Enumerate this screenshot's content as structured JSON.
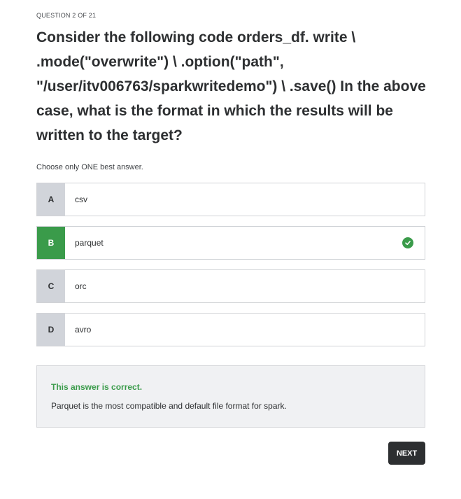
{
  "quiz": {
    "counter": "QUESTION 2 OF 21",
    "question": "Consider the following code orders_df. write \\ .mode(\"overwrite\") \\ .option(\"path\", \"/user/itv006763/sparkwritedemo\") \\ .save() In the above case, what is the format in which the results will be written to the target?",
    "instruction": "Choose only ONE best answer."
  },
  "options": [
    {
      "letter": "A",
      "text": "csv"
    },
    {
      "letter": "B",
      "text": "parquet",
      "correct": true
    },
    {
      "letter": "C",
      "text": "orc"
    },
    {
      "letter": "D",
      "text": "avro"
    }
  ],
  "feedback": {
    "title": "This answer is correct.",
    "explanation": "Parquet is the most compatible and default file format for spark."
  },
  "actions": {
    "next_label": "NEXT"
  },
  "colors": {
    "correct_green": "#3a9b4a",
    "letter_gray": "#d1d4da",
    "button_dark": "#2d2f31"
  },
  "icons": {
    "correct": "check-circle-icon"
  }
}
